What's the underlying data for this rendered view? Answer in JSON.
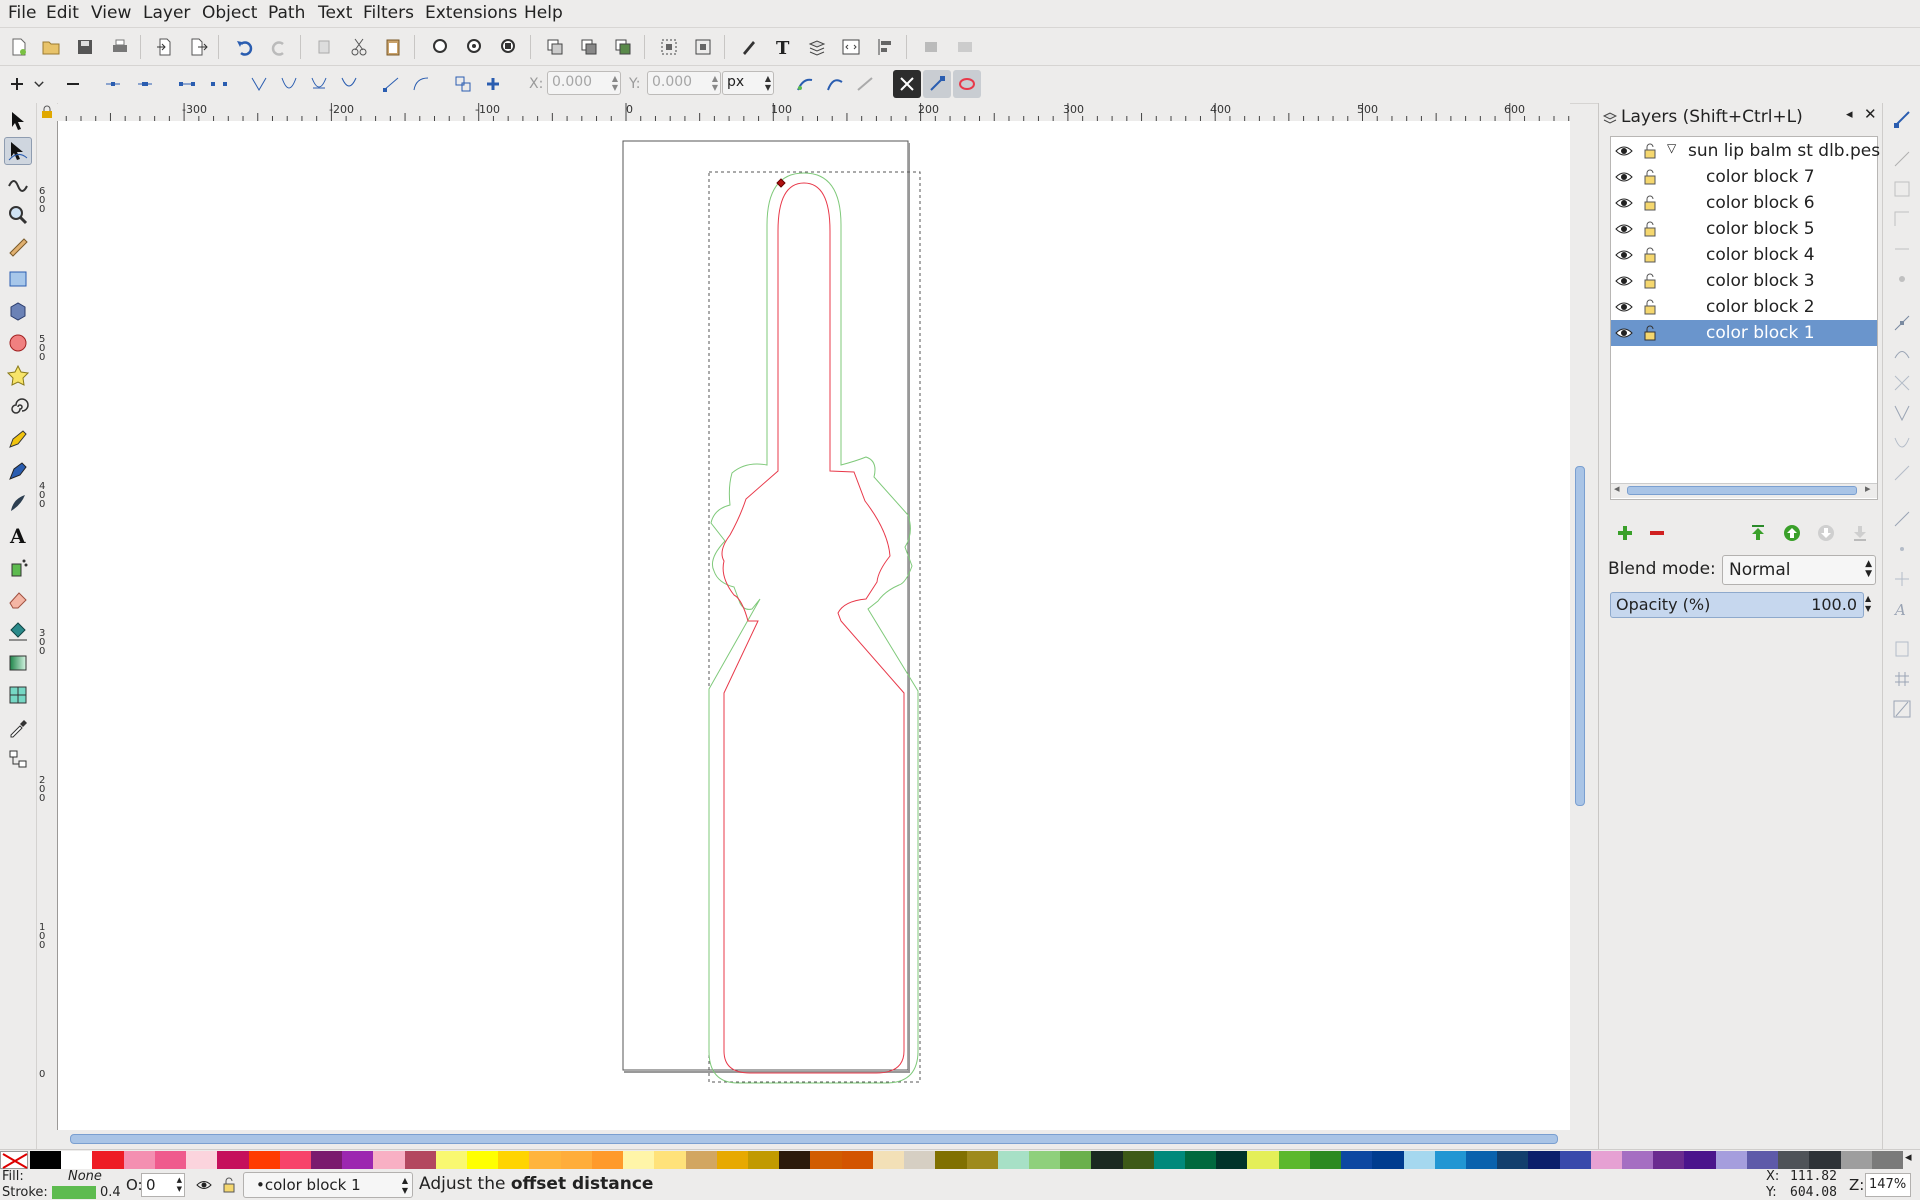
{
  "menu": [
    "File",
    "Edit",
    "View",
    "Layer",
    "Object",
    "Path",
    "Text",
    "Filters",
    "Extensions",
    "Help"
  ],
  "tool_controls": {
    "x_label": "X:",
    "x_value": "0.000",
    "y_label": "Y:",
    "y_value": "0.000",
    "unit": "px"
  },
  "ruler": {
    "top_ticks": [
      "-300",
      "-200",
      "-100",
      "0",
      "100",
      "200",
      "300",
      "400",
      "500",
      "600"
    ],
    "left_ticks": [
      "6\n0\n0",
      "5\n0\n0",
      "4\n0\n0",
      "3\n0\n0",
      "2\n0\n0",
      "1\n0\n0",
      "0"
    ]
  },
  "layers_panel": {
    "title": "Layers (Shift+Ctrl+L)",
    "root_layer": "sun lip balm st dlb.pes",
    "layers": [
      "color block 7",
      "color block 6",
      "color block 5",
      "color block 4",
      "color block 3",
      "color block 2",
      "color block 1"
    ],
    "selected_layer": "color block 1",
    "blend_label": "Blend mode:",
    "blend_value": "Normal",
    "opacity_label": "Opacity (%)",
    "opacity_value": "100.0"
  },
  "status": {
    "fill_label": "Fill:",
    "fill_value": "None",
    "stroke_label": "Stroke:",
    "stroke_width": "0.4",
    "opacity_label": "O:",
    "opacity_value": "0",
    "current_layer": "•color block 1",
    "message_prefix": "Adjust the ",
    "message_bold": "offset distance",
    "x_label": "X:",
    "x_value": "111.82",
    "y_label": "Y:",
    "y_value": "604.08",
    "zoom_label": "Z:",
    "zoom_value": "147%"
  },
  "colors": {
    "accent": "#6a95cc",
    "stroke_swatch": "#5dbb4f",
    "path_red": "#e8394a",
    "path_green": "#7fc97a"
  },
  "palette": [
    "#000000",
    "#ffffff",
    "#ee1c25",
    "#f48fb1",
    "#ef5b8d",
    "#fbd4dd",
    "#c5105c",
    "#ff3c00",
    "#f7436a",
    "#7a1a6e",
    "#9c27b0",
    "#f8b0c4",
    "#b3475f",
    "#f9f871",
    "#ffff00",
    "#ffd400",
    "#ffb43c",
    "#ffad3b",
    "#ff9a2b",
    "#fff5a8",
    "#ffe27a",
    "#d2a661",
    "#e7a900",
    "#c19a00",
    "#2b1a0b",
    "#d15c00",
    "#d35400",
    "#f3e0b7",
    "#d6cfc3",
    "#807000",
    "#9e8a1c",
    "#a7e0c6",
    "#8fd07c",
    "#6ab04c",
    "#1b2a21",
    "#3d5a17",
    "#00897b",
    "#00693e",
    "#00342a",
    "#e4ef58",
    "#5cb82c",
    "#2c8a22",
    "#0d47a1",
    "#003c8f",
    "#a5d8ef",
    "#2196d3",
    "#0a62ad",
    "#123f6d",
    "#0b1f6b",
    "#3949ab",
    "#e6a1d3",
    "#a56ec2",
    "#6a2b8f",
    "#4a148c",
    "#a59edd",
    "#5e5aa9",
    "#4f5358",
    "#2e3338",
    "#9e9e9e",
    "#7a7a7a"
  ]
}
